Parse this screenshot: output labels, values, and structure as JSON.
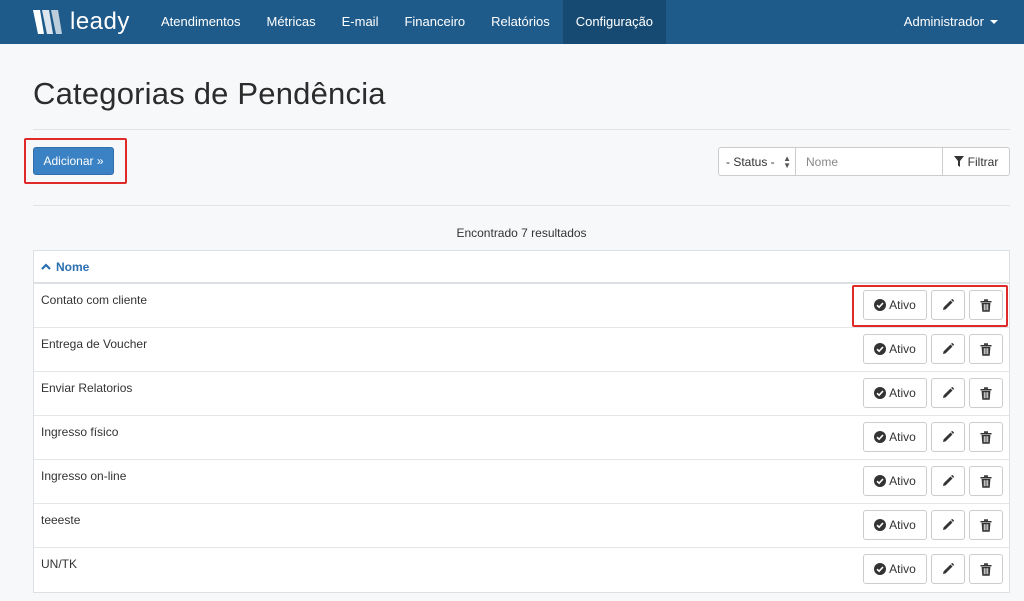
{
  "nav": {
    "brand": "leady",
    "items": [
      {
        "label": "Atendimentos",
        "active": false
      },
      {
        "label": "Métricas",
        "active": false
      },
      {
        "label": "E-mail",
        "active": false
      },
      {
        "label": "Financeiro",
        "active": false
      },
      {
        "label": "Relatórios",
        "active": false
      },
      {
        "label": "Configuração",
        "active": true
      }
    ],
    "user": "Administrador"
  },
  "page": {
    "title": "Categorias de Pendência",
    "add_button": "Adicionar »"
  },
  "filters": {
    "status_value": "- Status -",
    "name_placeholder": "Nome",
    "filter_button": "Filtrar"
  },
  "results_text": "Encontrado 7 resultados",
  "table": {
    "header": "Nome",
    "status_label": "Ativo",
    "rows": [
      {
        "name": "Contato com cliente"
      },
      {
        "name": "Entrega de Voucher"
      },
      {
        "name": "Enviar Relatorios"
      },
      {
        "name": "Ingresso físico"
      },
      {
        "name": "Ingresso on-line"
      },
      {
        "name": "teeeste"
      },
      {
        "name": "UN/TK"
      }
    ]
  },
  "colors": {
    "navbar": "#1e5a8a",
    "primary_button": "#3b82c4",
    "highlight": "#e02a2a"
  }
}
